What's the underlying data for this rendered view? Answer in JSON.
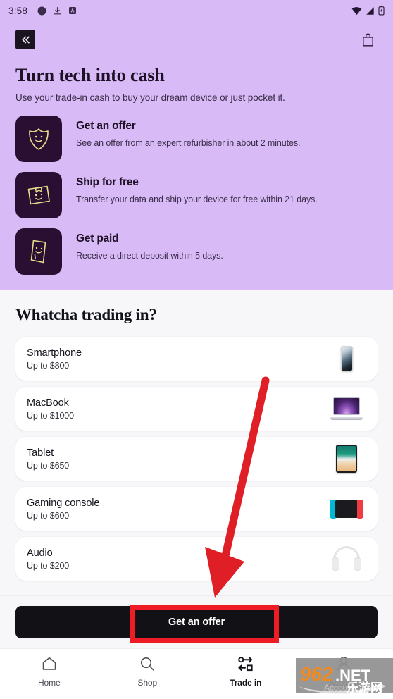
{
  "statusbar": {
    "time": "3:58",
    "icons": [
      "info-icon",
      "download-icon",
      "app-badge-icon"
    ],
    "right_icons": [
      "wifi-icon",
      "signal-icon",
      "battery-icon"
    ]
  },
  "hero": {
    "back_label": "Back",
    "bag_label": "Bag",
    "title": "Turn tech into cash",
    "subtitle": "Use your trade-in cash to buy your dream device or just pocket it.",
    "background_color": "#D8BBF6",
    "features": [
      {
        "icon": "shield-smiley-icon",
        "title": "Get an offer",
        "desc": "See an offer from an expert refurbisher in about 2 minutes."
      },
      {
        "icon": "box-smiley-icon",
        "title": "Ship for free",
        "desc": "Transfer your data and ship your device for free within 21 days."
      },
      {
        "icon": "card-smiley-icon",
        "title": "Get paid",
        "desc": "Receive a direct deposit within 5 days."
      }
    ]
  },
  "trade_in": {
    "section_title": "Whatcha trading in?",
    "items": [
      {
        "name": "Smartphone",
        "price": "Up to $800",
        "thumb": "smartphone-thumb"
      },
      {
        "name": "MacBook",
        "price": "Up to $1000",
        "thumb": "macbook-thumb"
      },
      {
        "name": "Tablet",
        "price": "Up to $650",
        "thumb": "tablet-thumb"
      },
      {
        "name": "Gaming console",
        "price": "Up to $600",
        "thumb": "gaming-console-thumb"
      },
      {
        "name": "Audio",
        "price": "Up to $200",
        "thumb": "headphones-thumb"
      }
    ]
  },
  "cta": {
    "label": "Get an offer",
    "highlight_color": "#EE1C25"
  },
  "bottom_nav": {
    "items": [
      {
        "label": "Home",
        "icon": "home-icon",
        "active": false
      },
      {
        "label": "Shop",
        "icon": "search-icon",
        "active": false
      },
      {
        "label": "Trade in",
        "icon": "swap-icon",
        "active": true
      },
      {
        "label": "Account",
        "icon": "person-icon",
        "active": false
      }
    ]
  },
  "watermark": {
    "primary": "962",
    "suffix": ".NET",
    "faint": "Account",
    "cn": "乐游网"
  }
}
